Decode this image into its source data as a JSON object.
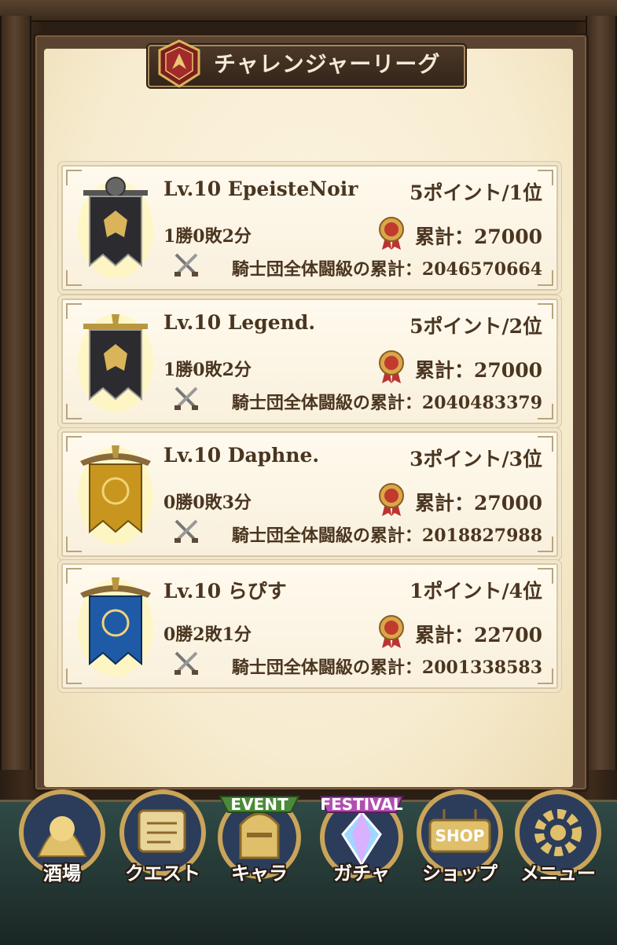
{
  "screen": {
    "title": "チャレンジャーリーグ"
  },
  "entries": [
    {
      "name": "Lv.10 EpeisteNoir",
      "points": "5ポイント/1位",
      "record": "1勝0敗2分",
      "total": "累計：27000",
      "guild_total": "騎士団全体闘級の累計：2046570664",
      "banner_color": "#2c2c30",
      "banner_type": "black-knight-banner-icon"
    },
    {
      "name": "Lv.10 Legend.",
      "points": "5ポイント/2位",
      "record": "1勝0敗2分",
      "total": "累計：27000",
      "guild_total": "騎士団全体闘級の累計：2040483379",
      "banner_color": "#2c2c30",
      "banner_type": "black-banner-icon"
    },
    {
      "name": "Lv.10 Daphne.",
      "points": "3ポイント/3位",
      "record": "0勝0敗3分",
      "total": "累計：27000",
      "guild_total": "騎士団全体闘級の累計：2018827988",
      "banner_color": "#c8961e",
      "banner_type": "gold-banner-icon"
    },
    {
      "name": "Lv.10 らぴす",
      "points": "1ポイント/4位",
      "record": "0勝2敗1分",
      "total": "累計：22700",
      "guild_total": "騎士団全体闘級の累計：2001338583",
      "banner_color": "#1f5aa6",
      "banner_type": "blue-banner-icon"
    }
  ],
  "nav": {
    "items": [
      {
        "label": "酒場",
        "icon": "tavern-icon"
      },
      {
        "label": "クエスト",
        "icon": "quest-scroll-icon"
      },
      {
        "label": "キャラ",
        "icon": "knight-helmet-icon",
        "badge": "EVENT"
      },
      {
        "label": "ガチャ",
        "icon": "crystal-icon",
        "badge": "FESTIVAL"
      },
      {
        "label": "ショップ",
        "icon": "shop-sign-icon",
        "badge": "SHOP"
      },
      {
        "label": "メニュー",
        "icon": "gear-icon"
      }
    ]
  },
  "colors": {
    "parchment": "#f7ecd0",
    "text": "#4a3520",
    "nav_bg": "#233532",
    "gold": "#d9b45a"
  }
}
